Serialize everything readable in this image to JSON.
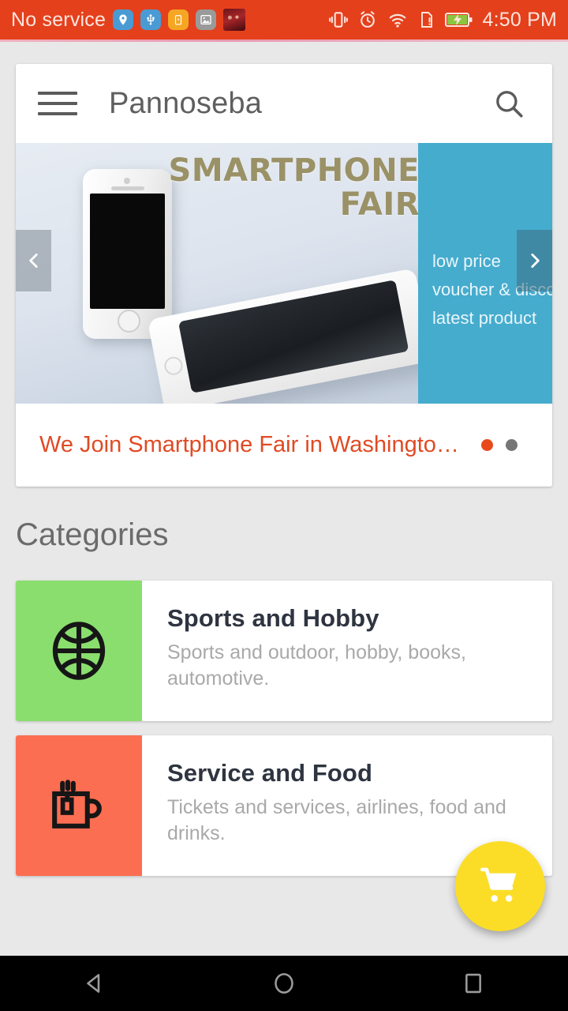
{
  "statusbar": {
    "carrier": "No service",
    "time": "4:50 PM",
    "background_color": "#e4401c",
    "left_icons": [
      "location-pin-icon",
      "usb-icon",
      "battery-saver-icon",
      "image-icon",
      "media-thumbnail"
    ],
    "right_icons": [
      "vibrate-icon",
      "alarm-icon",
      "wifi-icon",
      "sim-alert-icon",
      "battery-charging-icon"
    ]
  },
  "toolbar": {
    "title": "Pannoseba",
    "menu_icon": "hamburger-icon",
    "search_icon": "search-icon"
  },
  "carousel": {
    "banner_headline_line1": "SMARTPHONE",
    "banner_headline_line2": "FAIR",
    "panel_lines": [
      "low price",
      "voucher & discount",
      "latest product"
    ],
    "panel_color": "#45acce",
    "prev_label": "‹",
    "next_label": "›",
    "caption": "We Join Smartphone Fair  in Washington,…",
    "caption_color": "#e04a24",
    "dots": [
      {
        "state": "active",
        "color": "#e8491c"
      },
      {
        "state": "idle",
        "color": "#767676"
      }
    ]
  },
  "categories": {
    "section_title": "Categories",
    "items": [
      {
        "title": "Sports and Hobby",
        "description": "Sports and outdoor, hobby, books, automotive.",
        "icon": "basketball-icon",
        "tile_color": "#8ade6e"
      },
      {
        "title": "Service and Food",
        "description": "Tickets and services, airlines, food and drinks.",
        "icon": "tea-cup-icon",
        "tile_color": "#fc6e52"
      }
    ]
  },
  "fab": {
    "icon": "shopping-cart-icon",
    "color": "#fbdd27"
  },
  "navbar": {
    "back": "back-triangle-icon",
    "home": "home-circle-icon",
    "recents": "recents-square-icon"
  }
}
